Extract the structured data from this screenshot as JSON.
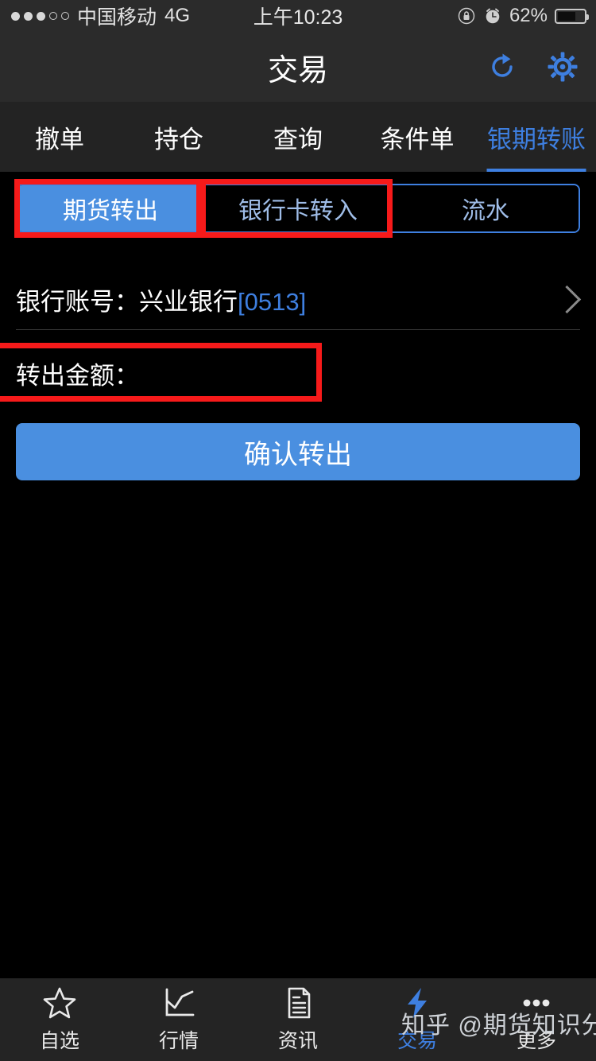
{
  "status_bar": {
    "signal_dots_filled": 3,
    "signal_dots_total": 5,
    "carrier": "中国移动",
    "network": "4G",
    "time": "上午10:23",
    "battery_percent": "62%",
    "rotation_lock_icon": "rotation-lock-icon",
    "alarm_icon": "alarm-clock-icon",
    "battery_icon": "battery-icon"
  },
  "navbar": {
    "title": "交易",
    "refresh_icon": "refresh-icon",
    "settings_icon": "gear-icon",
    "icon_color": "#3e7fe0"
  },
  "top_tabs": {
    "items": [
      {
        "label": "撤单",
        "active": false
      },
      {
        "label": "持仓",
        "active": false
      },
      {
        "label": "查询",
        "active": false
      },
      {
        "label": "条件单",
        "active": false
      },
      {
        "label": "银期转账",
        "active": true
      }
    ],
    "active_color": "#3e7fe0",
    "inactive_color": "#ffffff"
  },
  "segmented_control": {
    "options": [
      {
        "label": "期货转出",
        "selected": true
      },
      {
        "label": "银行卡转入",
        "selected": false
      },
      {
        "label": "流水",
        "selected": false
      }
    ],
    "selected_bg": "#4a8fe0",
    "border_color": "#3e7fe0"
  },
  "bank_row": {
    "label": "银行账号：兴业银行",
    "account_code": "[0513]",
    "code_color": "#3e7fe0",
    "chevron_icon": "chevron-right-icon"
  },
  "amount_row": {
    "label": "转出金额：",
    "value": "",
    "placeholder": ""
  },
  "confirm_button": {
    "label": "确认转出",
    "background": "#4a8fe0"
  },
  "annotations": {
    "color": "#f61a1a",
    "boxes": [
      {
        "target": "期货转出"
      },
      {
        "target": "银行卡转入"
      },
      {
        "target": "转出金额："
      }
    ]
  },
  "bottom_tabs": {
    "items": [
      {
        "label": "自选",
        "icon": "star-icon",
        "active": false
      },
      {
        "label": "行情",
        "icon": "line-chart-icon",
        "active": false
      },
      {
        "label": "资讯",
        "icon": "document-icon",
        "active": false
      },
      {
        "label": "交易",
        "icon": "lightning-bolt-icon",
        "active": true
      },
      {
        "label": "更多",
        "icon": "ellipsis-icon",
        "active": false
      }
    ],
    "active_color": "#3e7fe0"
  },
  "watermark": {
    "text": "知乎 @期货知识分享"
  }
}
